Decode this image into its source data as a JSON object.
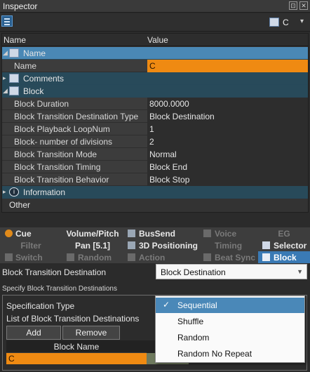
{
  "window": {
    "title": "Inspector"
  },
  "toolbar": {
    "selected_object": "C"
  },
  "grid": {
    "col_name": "Name",
    "col_value": "Value",
    "rows": [
      {
        "kind": "cat",
        "label": "Name",
        "expanded": true,
        "icon": "name-category-icon"
      },
      {
        "kind": "prop",
        "label": "Name",
        "value": "C"
      },
      {
        "kind": "cat",
        "label": "Comments",
        "expanded": false,
        "icon": "comments-category-icon"
      },
      {
        "kind": "cat",
        "label": "Block",
        "expanded": true,
        "icon": "block-category-icon"
      },
      {
        "kind": "prop",
        "label": "Block Duration",
        "value": "8000.0000"
      },
      {
        "kind": "prop",
        "label": "Block Transition Destination Type",
        "value": "Block Destination"
      },
      {
        "kind": "prop",
        "label": "Block Playback LoopNum",
        "value": "1"
      },
      {
        "kind": "prop",
        "label": "Block- number of divisions",
        "value": "2"
      },
      {
        "kind": "prop",
        "label": "Block Transition Mode",
        "value": "Normal"
      },
      {
        "kind": "prop",
        "label": "Block Transition Timing",
        "value": "Block End"
      },
      {
        "kind": "prop",
        "label": "Block Transition Behavior",
        "value": "Block Stop"
      },
      {
        "kind": "cat",
        "label": "Information",
        "expanded": false,
        "icon": "information-icon"
      },
      {
        "kind": "other",
        "label": "Other"
      }
    ]
  },
  "tabs": [
    {
      "label": "Cue",
      "state": "normal",
      "icon": "cue-icon"
    },
    {
      "label": "Volume/Pitch",
      "state": "normal",
      "icon": ""
    },
    {
      "label": "BusSend",
      "state": "normal",
      "icon": "bussend-icon"
    },
    {
      "label": "Voice",
      "state": "disabled",
      "icon": "voice-icon"
    },
    {
      "label": "EG",
      "state": "disabled",
      "icon": ""
    },
    {
      "label": "Filter",
      "state": "disabled",
      "icon": ""
    },
    {
      "label": "Pan [5.1]",
      "state": "normal",
      "icon": ""
    },
    {
      "label": "3D Positioning",
      "state": "normal",
      "icon": "3d-positioning-icon"
    },
    {
      "label": "Timing",
      "state": "disabled",
      "icon": ""
    },
    {
      "label": "Selector",
      "state": "normal",
      "icon": "selector-icon"
    },
    {
      "label": "Switch",
      "state": "disabled",
      "icon": "switch-icon"
    },
    {
      "label": "Random",
      "state": "disabled",
      "icon": "random-icon"
    },
    {
      "label": "Action",
      "state": "disabled",
      "icon": "action-icon"
    },
    {
      "label": "Beat Sync",
      "state": "disabled",
      "icon": "beat-sync-icon"
    },
    {
      "label": "Block",
      "state": "active",
      "icon": "block-tab-icon"
    }
  ],
  "block_panel": {
    "destination_label": "Block Transition Destination",
    "destination_value": "Block Destination",
    "specify_label": "Specify Block Transition Destinations",
    "spec_type_label": "Specification Type",
    "list_label": "List of Block Transition Destinations",
    "add_label": "Add",
    "remove_label": "Remove",
    "block_name_header": "Block Name",
    "block_name_row": "C"
  },
  "dropdown": {
    "options": [
      "Sequential",
      "Shuffle",
      "Random",
      "Random No Repeat"
    ],
    "selected": "Sequential"
  }
}
